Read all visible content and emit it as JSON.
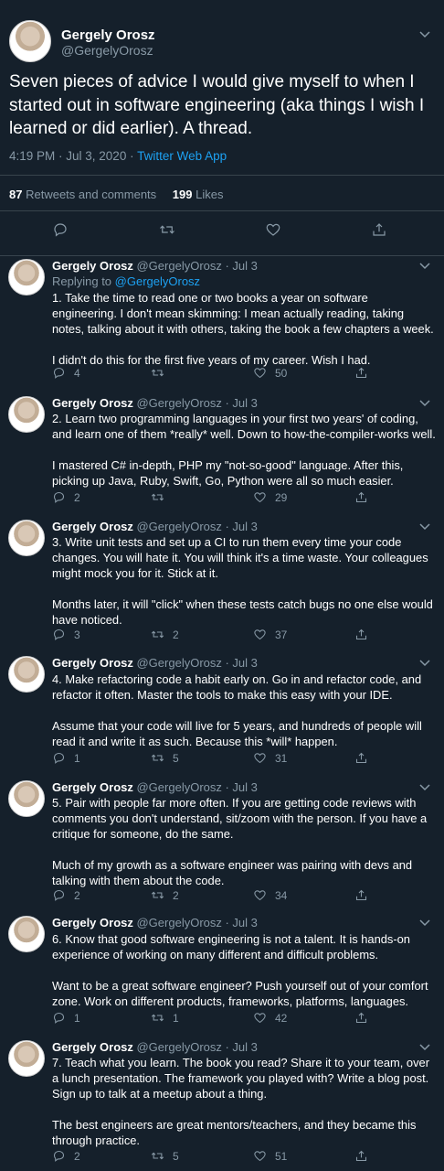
{
  "main_tweet": {
    "author_name": "Gergely Orosz",
    "author_handle": "@GergelyOrosz",
    "text": "Seven pieces of advice I would give myself to when I started out in software engineering (aka things I wish I learned or did earlier). A thread.",
    "time": "4:19 PM · Jul 3, 2020 · ",
    "app": "Twitter Web App",
    "retweets_count": "87",
    "retweets_label": "Retweets and comments",
    "likes_count": "199",
    "likes_label": "Likes"
  },
  "replies": [
    {
      "name": "Gergely Orosz",
      "meta": " @GergelyOrosz · Jul 3",
      "replying_to": "Replying to ",
      "mention": "@GergelyOrosz",
      "text": "1. Take the time to read one or two books a year on software engineering. I don't mean skimming: I mean actually reading, taking notes, talking about it with others, taking the book a few chapters a week.\n\nI didn't do this for the first five years of my career. Wish I had.",
      "replies": "4",
      "retweets": "",
      "likes": "50"
    },
    {
      "name": "Gergely Orosz",
      "meta": " @GergelyOrosz · Jul 3",
      "text": "2. Learn two programming languages in your first two years' of coding, and learn one of them *really* well. Down to how-the-compiler-works well.\n\nI mastered C# in-depth, PHP my \"not-so-good\" language. After this, picking up Java, Ruby, Swift, Go, Python were all so much easier.",
      "replies": "2",
      "retweets": "",
      "likes": "29"
    },
    {
      "name": "Gergely Orosz",
      "meta": " @GergelyOrosz · Jul 3",
      "text": "3. Write unit tests and set up a CI to run them every time your code changes. You will hate it. You will think it's a time waste. Your colleagues might mock you for it. Stick at it.\n\nMonths later, it will \"click\" when these tests catch bugs no one else would have noticed.",
      "replies": "3",
      "retweets": "2",
      "likes": "37"
    },
    {
      "name": "Gergely Orosz",
      "meta": " @GergelyOrosz · Jul 3",
      "text": "4. Make refactoring code a habit early on. Go in and refactor code, and refactor it often. Master the tools to make this easy with your IDE.\n\nAssume that your code will live for 5 years, and hundreds of people will read it and write it as such. Because this *will* happen.",
      "replies": "1",
      "retweets": "5",
      "likes": "31"
    },
    {
      "name": "Gergely Orosz",
      "meta": " @GergelyOrosz · Jul 3",
      "text": "5. Pair with people far more often. If you are getting code reviews with comments you don't understand, sit/zoom with the person. If you have a critique for someone, do the same.\n\nMuch of my growth as a software engineer was pairing with devs and talking with them about the code.",
      "replies": "2",
      "retweets": "2",
      "likes": "34"
    },
    {
      "name": "Gergely Orosz",
      "meta": " @GergelyOrosz · Jul 3",
      "text": "6. Know that good software engineering is not a talent. It is hands-on experience of working on many different and difficult problems.\n\nWant to be a great software engineer? Push yourself out of your comfort zone. Work on different products, frameworks, platforms, languages.",
      "replies": "1",
      "retweets": "1",
      "likes": "42"
    },
    {
      "name": "Gergely Orosz",
      "meta": " @GergelyOrosz · Jul 3",
      "text": "7. Teach what you learn. The book you read? Share it to your team, over a lunch presentation. The framework you played with? Write a blog post. Sign up to talk at a meetup about a thing.\n\nThe best engineers are great mentors/teachers, and they became this through practice.",
      "replies": "2",
      "retweets": "5",
      "likes": "51"
    }
  ],
  "icons": {
    "reply": "speech-bubble-icon",
    "retweet": "retweet-arrows-icon",
    "like": "heart-icon",
    "share": "share-upload-icon",
    "more": "chevron-down-icon"
  },
  "colors": {
    "background": "#15202b",
    "accent": "#1da1f2",
    "muted": "#8899a6",
    "divider": "#38444d"
  }
}
